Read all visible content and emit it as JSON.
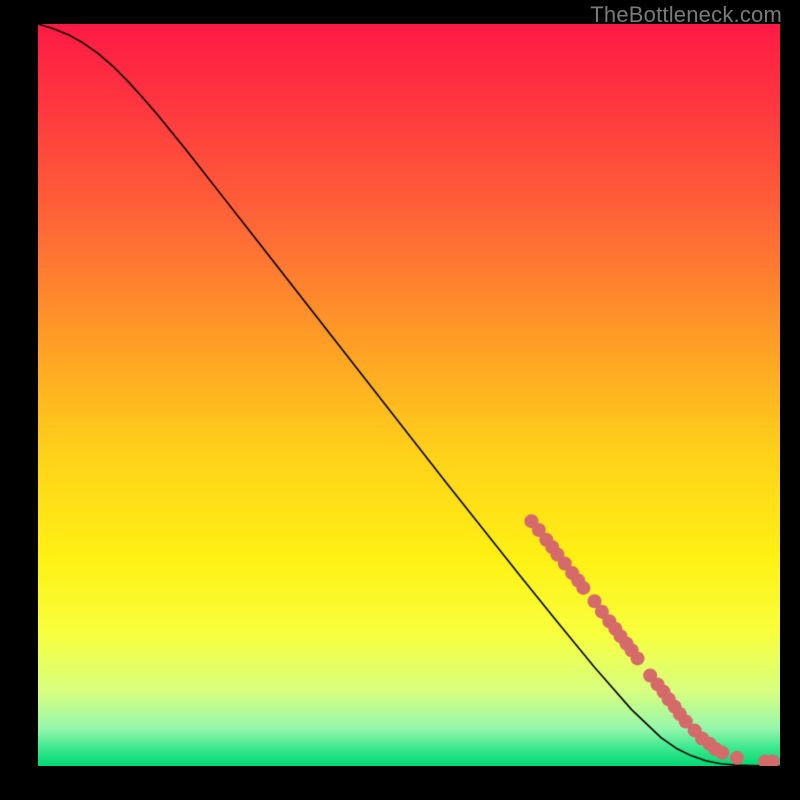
{
  "watermark": "TheBottleneck.com",
  "chart_data": {
    "type": "line",
    "title": "",
    "xlabel": "",
    "ylabel": "",
    "xlim": [
      0,
      100
    ],
    "ylim": [
      0,
      100
    ],
    "grid": false,
    "legend": false,
    "background": {
      "gradient_stops": [
        {
          "pos": 0.0,
          "color": "#ff1a45"
        },
        {
          "pos": 0.12,
          "color": "#ff3a3f"
        },
        {
          "pos": 0.28,
          "color": "#ff6a36"
        },
        {
          "pos": 0.44,
          "color": "#ffa225"
        },
        {
          "pos": 0.58,
          "color": "#ffd21a"
        },
        {
          "pos": 0.72,
          "color": "#fff114"
        },
        {
          "pos": 0.82,
          "color": "#f8ff3d"
        },
        {
          "pos": 0.9,
          "color": "#d8ff81"
        },
        {
          "pos": 0.95,
          "color": "#95f7ac"
        },
        {
          "pos": 0.975,
          "color": "#3fe88f"
        },
        {
          "pos": 1.0,
          "color": "#00d973"
        }
      ]
    },
    "series": [
      {
        "name": "bottleneck-curve",
        "color": "#000000",
        "width": 1.6,
        "x": [
          0,
          2,
          4,
          6,
          8,
          10,
          12,
          14,
          16,
          20,
          25,
          30,
          35,
          40,
          45,
          50,
          55,
          60,
          65,
          70,
          75,
          80,
          84,
          86,
          88,
          90,
          92,
          94,
          96,
          98,
          100
        ],
        "y": [
          100,
          99.4,
          98.6,
          97.5,
          96.1,
          94.4,
          92.4,
          90.2,
          87.9,
          83.0,
          76.6,
          70.2,
          63.8,
          57.4,
          51.0,
          44.6,
          38.2,
          31.9,
          25.6,
          19.4,
          13.3,
          7.6,
          3.8,
          2.4,
          1.4,
          0.7,
          0.3,
          0.12,
          0.05,
          0.02,
          0.0
        ]
      }
    ],
    "scatter": {
      "name": "highlighted-points",
      "color": "#d46a6a",
      "radius": 7,
      "points": [
        {
          "x": 66.5,
          "y": 33.0
        },
        {
          "x": 67.5,
          "y": 31.8
        },
        {
          "x": 68.5,
          "y": 30.5
        },
        {
          "x": 69.3,
          "y": 29.5
        },
        {
          "x": 70.0,
          "y": 28.5
        },
        {
          "x": 71.0,
          "y": 27.3
        },
        {
          "x": 72.0,
          "y": 26.0
        },
        {
          "x": 72.8,
          "y": 25.0
        },
        {
          "x": 73.5,
          "y": 24.0
        },
        {
          "x": 75.0,
          "y": 22.2
        },
        {
          "x": 76.0,
          "y": 20.8
        },
        {
          "x": 77.0,
          "y": 19.5
        },
        {
          "x": 77.8,
          "y": 18.5
        },
        {
          "x": 78.5,
          "y": 17.5
        },
        {
          "x": 79.3,
          "y": 16.5
        },
        {
          "x": 80.0,
          "y": 15.6
        },
        {
          "x": 80.8,
          "y": 14.5
        },
        {
          "x": 82.5,
          "y": 12.2
        },
        {
          "x": 83.5,
          "y": 11.0
        },
        {
          "x": 84.3,
          "y": 10.0
        },
        {
          "x": 85.0,
          "y": 9.0
        },
        {
          "x": 85.8,
          "y": 8.0
        },
        {
          "x": 86.5,
          "y": 7.0
        },
        {
          "x": 87.3,
          "y": 6.0
        },
        {
          "x": 88.5,
          "y": 4.8
        },
        {
          "x": 89.5,
          "y": 3.7
        },
        {
          "x": 90.5,
          "y": 3.0
        },
        {
          "x": 91.3,
          "y": 2.3
        },
        {
          "x": 92.2,
          "y": 1.8
        },
        {
          "x": 94.2,
          "y": 1.1
        },
        {
          "x": 98.0,
          "y": 0.6
        },
        {
          "x": 99.0,
          "y": 0.6
        }
      ]
    }
  }
}
